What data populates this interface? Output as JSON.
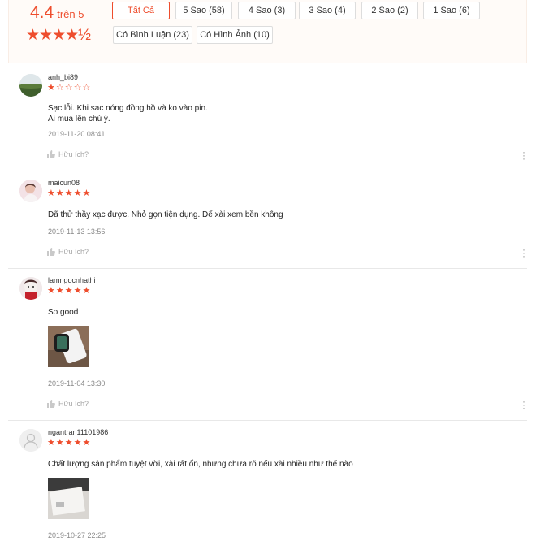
{
  "summary": {
    "score": "4.4",
    "score_suffix": "trên 5",
    "stars": "★★★★½",
    "filters_row1": [
      "Tất Cả",
      "5 Sao (58)",
      "4 Sao (3)",
      "3 Sao (4)",
      "2 Sao (2)",
      "1 Sao (6)"
    ],
    "filters_row2": [
      "Có Bình Luận (23)",
      "Có Hình Ảnh (10)"
    ],
    "active_filter": "Tất Cả"
  },
  "reviews": [
    {
      "username": "anh_bi89",
      "rating": 1,
      "stars_filled": "★",
      "stars_empty": "☆☆☆☆",
      "lines": [
        "Sạc lỗi. Khi sạc nóng đồng hồ và ko vào pin.",
        "Ai mua lên chú ý."
      ],
      "date": "2019-11-20 08:41",
      "helpful": "Hữu ích?"
    },
    {
      "username": "maicun08",
      "rating": 5,
      "stars_filled": "★★★★★",
      "stars_empty": "",
      "lines": [
        "Đã thử thầy xạc được. Nhỏ gọn tiện dụng. Để xài xem bền không"
      ],
      "date": "2019-11-13 13:56",
      "helpful": "Hữu ích?"
    },
    {
      "username": "lamngocnhathi",
      "rating": 5,
      "stars_filled": "★★★★★",
      "stars_empty": "",
      "lines": [
        "So good"
      ],
      "date": "2019-11-04 13:30",
      "helpful": "Hữu ích?"
    },
    {
      "username": "ngantran11101986",
      "rating": 5,
      "stars_filled": "★★★★★",
      "stars_empty": "",
      "lines": [
        "Chất lượng sản phẩm tuyệt vời, xài rất ổn, nhưng chưa rõ nếu xài nhiều như thế nào"
      ],
      "date": "2019-10-27 22:25",
      "helpful": ""
    }
  ],
  "colors": {
    "accent": "#ee4d2d",
    "summary_bg": "#fffbf8",
    "muted_text": "#8a8a8a"
  },
  "icons": {
    "thumbs_up": "thumbs-up-icon",
    "more": "more-vertical-icon",
    "default_avatar": "user-icon"
  }
}
